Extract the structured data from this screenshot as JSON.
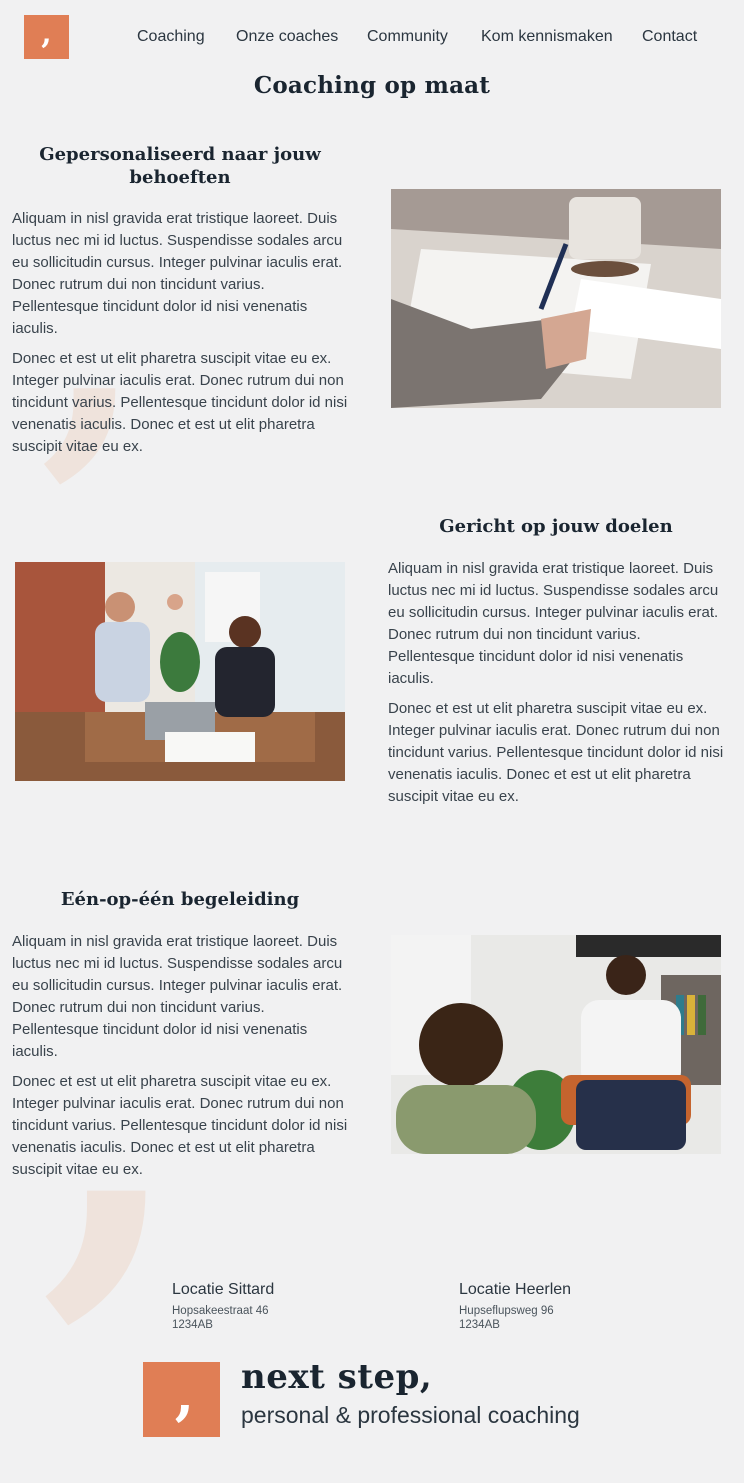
{
  "logo": {
    "glyph": ","
  },
  "nav": {
    "items": [
      {
        "label": "Coaching"
      },
      {
        "label": "Onze coaches"
      },
      {
        "label": "Community"
      },
      {
        "label": "Kom kennismaken"
      },
      {
        "label": "Contact"
      }
    ]
  },
  "page": {
    "title": "Coaching op maat"
  },
  "sections": [
    {
      "title": "Gepersonaliseerd naar jouw behoeften",
      "paragraphs": [
        "Aliquam in nisl gravida erat tristique laoreet. Duis luctus nec mi id luctus. Suspendisse sodales arcu eu sollicitudin cursus. Integer pulvinar iaculis erat. Donec rutrum dui non tincidunt varius. Pellentesque tincidunt dolor id nisi venenatis iaculis.",
        "Donec et est ut elit pharetra suscipit vitae eu ex. Integer pulvinar iaculis erat. Donec rutrum dui non tincidunt varius. Pellentesque tincidunt dolor id nisi venenatis iaculis. Donec et est ut elit pharetra suscipit vitae eu ex."
      ]
    },
    {
      "title": "Gericht op jouw doelen",
      "paragraphs": [
        "Aliquam in nisl gravida erat tristique laoreet. Duis luctus nec mi id luctus. Suspendisse sodales arcu eu sollicitudin cursus. Integer pulvinar iaculis erat. Donec rutrum dui non tincidunt varius. Pellentesque tincidunt dolor id nisi venenatis iaculis.",
        "Donec et est ut elit pharetra suscipit vitae eu ex. Integer pulvinar iaculis erat. Donec rutrum dui non tincidunt varius. Pellentesque tincidunt dolor id nisi venenatis iaculis. Donec et est ut elit pharetra suscipit vitae eu ex."
      ]
    },
    {
      "title": "Eén-op-één begeleiding",
      "paragraphs": [
        "Aliquam in nisl gravida erat tristique laoreet. Duis luctus nec mi id luctus. Suspendisse sodales arcu eu sollicitudin cursus. Integer pulvinar iaculis erat. Donec rutrum dui non tincidunt varius. Pellentesque tincidunt dolor id nisi venenatis iaculis.",
        "Donec et est ut elit pharetra suscipit vitae eu ex. Integer pulvinar iaculis erat. Donec rutrum dui non tincidunt varius. Pellentesque tincidunt dolor id nisi venenatis iaculis. Donec et est ut elit pharetra suscipit vitae eu ex."
      ]
    }
  ],
  "locations": [
    {
      "title": "Locatie Sittard",
      "street": "Hopsakeestraat 46",
      "postcode": "1234AB"
    },
    {
      "title": "Locatie Heerlen",
      "street": "Hupseflupsweg 96",
      "postcode": "1234AB"
    }
  ],
  "footer": {
    "brand_name": "next step,",
    "tagline": "personal & professional coaching"
  },
  "colors": {
    "accent": "#e07e55",
    "background": "#f1f1f2",
    "heading": "#1a2530",
    "watermark": "#efe3dc"
  }
}
